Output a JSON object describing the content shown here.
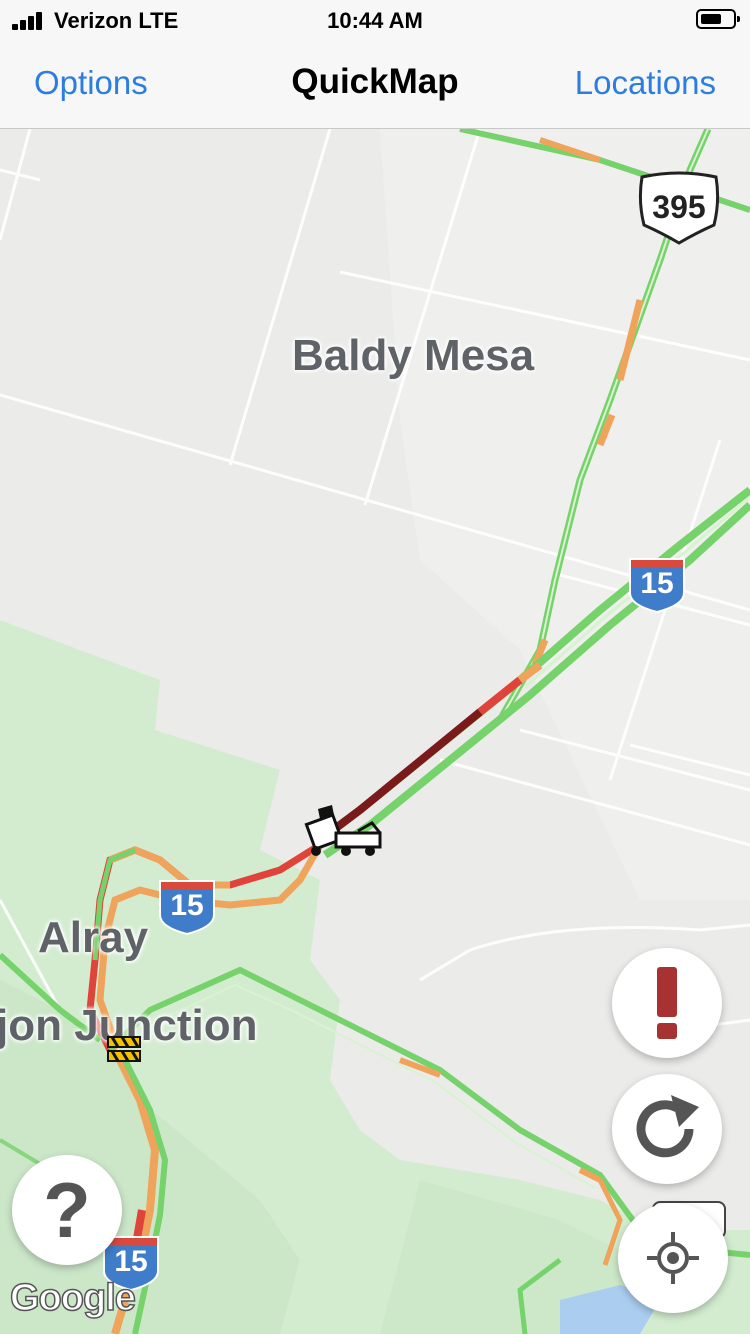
{
  "status_bar": {
    "carrier": "Verizon LTE",
    "time": "10:44 AM"
  },
  "nav": {
    "left_button": "Options",
    "title": "QuickMap",
    "right_button": "Locations"
  },
  "map": {
    "places": [
      {
        "name": "Baldy Mesa"
      },
      {
        "name": "Alray"
      },
      {
        "name": "jon Junction"
      }
    ],
    "shields": {
      "interstate_15": "15",
      "us_395": "395"
    },
    "attribution": "Google"
  },
  "buttons": {
    "alert_icon": "alert-icon",
    "refresh_icon": "refresh-icon",
    "help_label": "?",
    "locate_icon": "crosshair-icon"
  },
  "colors": {
    "nav_accent": "#2d7de0",
    "traffic_green": "#76d26a",
    "traffic_orange": "#f0a35a",
    "traffic_red": "#e0433a",
    "traffic_dark_red": "#7a1a1a",
    "interstate_blue": "#3f7cc9",
    "alert_red": "#a83232"
  }
}
